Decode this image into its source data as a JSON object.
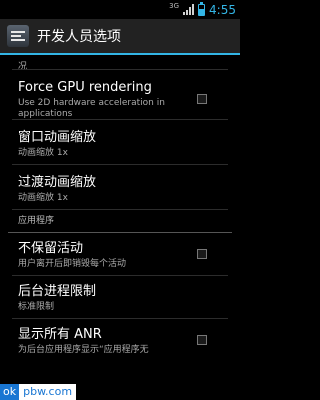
{
  "status_bar": {
    "network_label": "3G",
    "battery_level": 0.6,
    "time": "4:55"
  },
  "action_bar": {
    "app_icon": "developer-options-icon",
    "title": "开发人员选项"
  },
  "list": {
    "top_fragment": "况",
    "gpu": {
      "title": "Force GPU rendering",
      "summary": "Use 2D hardware acceleration in applications",
      "checked": false
    },
    "window_anim": {
      "title": "窗口动画缩放",
      "summary": "动画缩放 1x"
    },
    "transition_anim": {
      "title": "过渡动画缩放",
      "summary": "动画缩放 1x"
    },
    "apps_section": "应用程序",
    "dont_keep": {
      "title": "不保留活动",
      "summary": "用户离开后即销毁每个活动",
      "checked": false
    },
    "bg_limit": {
      "title": "后台进程限制",
      "summary": "标准限制"
    },
    "show_anr": {
      "title": "显示所有 ANR",
      "summary": "为后台应用程序显示“应用程序无",
      "checked": false
    }
  },
  "watermark": {
    "prefix": "ok",
    "rest": "pbw.com"
  },
  "colors": {
    "accent": "#33b5e5",
    "action_bar_bg": "#222222",
    "background": "#000000"
  }
}
